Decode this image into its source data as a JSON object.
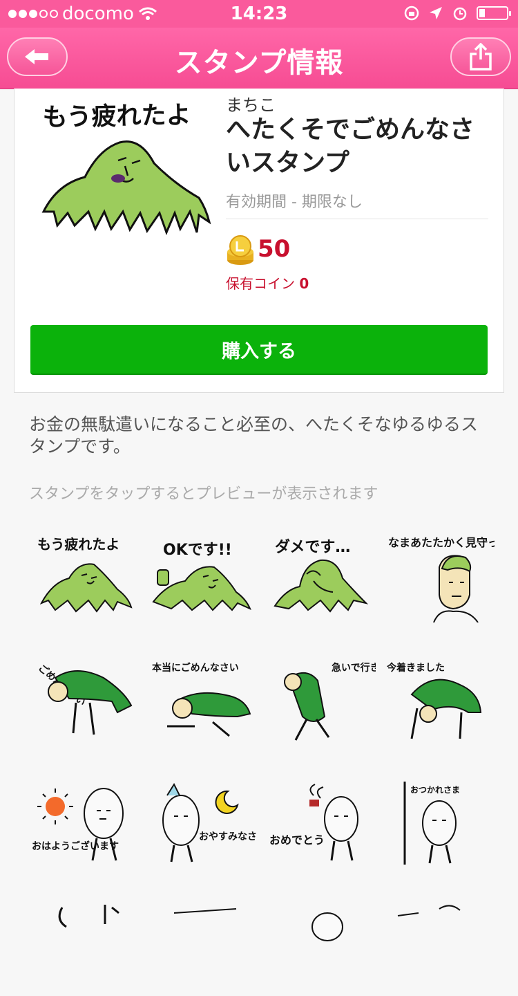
{
  "status_bar": {
    "carrier": "docomo",
    "time": "14:23"
  },
  "nav": {
    "title": "スタンプ情報"
  },
  "product": {
    "author": "まちこ",
    "title": "へたくそでごめんなさいスタンプ",
    "period": "有効期間 - 期限なし",
    "price": "50",
    "owned_label": "保有コイン",
    "owned_value": "0",
    "buy_label": "購入する",
    "main_stamp_text": "もう疲れたよ"
  },
  "description": "お金の無駄遣いになること必至の、へたくそなゆるゆるスタンプです。",
  "hint": "スタンプをタップするとプレビューが表示されます",
  "stamps": [
    {
      "text": "もう疲れたよ"
    },
    {
      "text": "OKです!!"
    },
    {
      "text": "ダメです…"
    },
    {
      "text": "なまあたたかく見守ってるよ"
    },
    {
      "text": "ごめんなさい"
    },
    {
      "text": "本当にごめんなさい"
    },
    {
      "text": "急いで行きます"
    },
    {
      "text": "今着きました"
    },
    {
      "text": "おはようございます"
    },
    {
      "text": "おやすみなさい"
    },
    {
      "text": "おめでとう"
    },
    {
      "text": "おつかれさま"
    }
  ],
  "colors": {
    "nav_pink": "#fa5a9c",
    "buy_green": "#0bb20b",
    "price_red": "#c8102e",
    "mountain_green": "#9ccc5c"
  }
}
